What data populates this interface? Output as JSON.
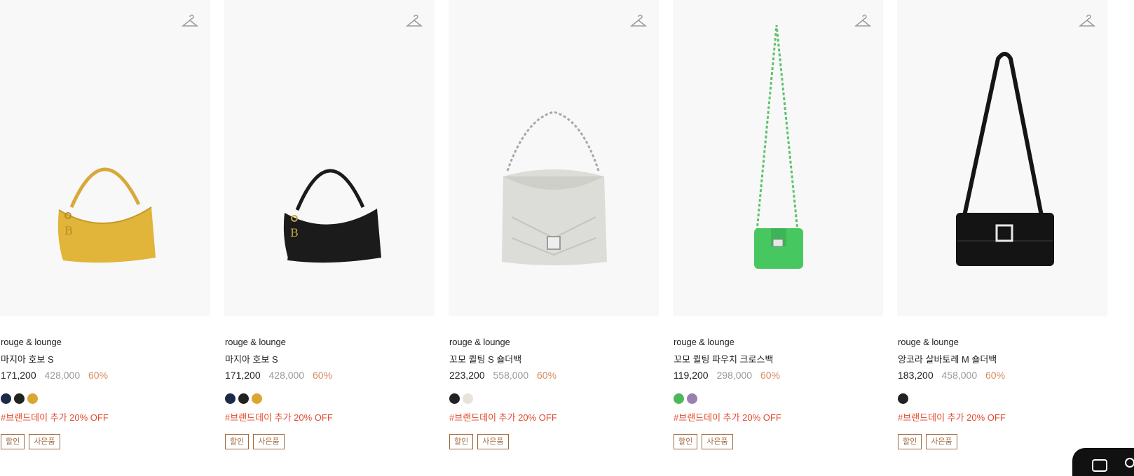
{
  "products": [
    {
      "brand": "rouge & lounge",
      "name": "마지아 호보 S",
      "sale_price": "171,200",
      "original_price": "428,000",
      "discount": "60%",
      "promo": "#브랜드데이 추가 20% OFF",
      "tags": [
        "할인",
        "사은품"
      ],
      "swatches": [
        "#1c2a4a",
        "#222222",
        "#d9a634"
      ],
      "bag_color": "#e1b43a",
      "icon": "hanger-icon"
    },
    {
      "brand": "rouge & lounge",
      "name": "마지아 호보 S",
      "sale_price": "171,200",
      "original_price": "428,000",
      "discount": "60%",
      "promo": "#브랜드데이 추가 20% OFF",
      "tags": [
        "할인",
        "사은품"
      ],
      "swatches": [
        "#1c2a4a",
        "#222222",
        "#d9a634"
      ],
      "bag_color": "#1b1b1b",
      "icon": "hanger-icon"
    },
    {
      "brand": "rouge & lounge",
      "name": "꼬모 퀼팅 S 숄더백",
      "sale_price": "223,200",
      "original_price": "558,000",
      "discount": "60%",
      "promo": "#브랜드데이 추가 20% OFF",
      "tags": [
        "할인",
        "사은품"
      ],
      "swatches": [
        "#222222",
        "#e8e3da"
      ],
      "bag_color": "#dcdcd8",
      "icon": "hanger-icon"
    },
    {
      "brand": "rouge & lounge",
      "name": "꼬모 퀼팅 파우치 크로스백",
      "sale_price": "119,200",
      "original_price": "298,000",
      "discount": "60%",
      "promo": "#브랜드데이 추가 20% OFF",
      "tags": [
        "할인",
        "사은품"
      ],
      "swatches": [
        "#4cb85a",
        "#9a7fb3"
      ],
      "bag_color": "#47c760",
      "icon": "hanger-icon"
    },
    {
      "brand": "rouge & lounge",
      "name": "앙코라 살바토레 M 숄더백",
      "sale_price": "183,200",
      "original_price": "458,000",
      "discount": "60%",
      "promo": "#브랜드데이 추가 20% OFF",
      "tags": [
        "할인",
        "사은품"
      ],
      "swatches": [
        "#222222"
      ],
      "bag_color": "#141414",
      "icon": "hanger-icon"
    }
  ],
  "colors": {
    "promo_text": "#e3492b",
    "discount_text": "#d68a5c",
    "tag_border": "#a0693f",
    "image_bg": "#f8f8f8"
  },
  "floating_button": {
    "icon": "chat-icon"
  }
}
